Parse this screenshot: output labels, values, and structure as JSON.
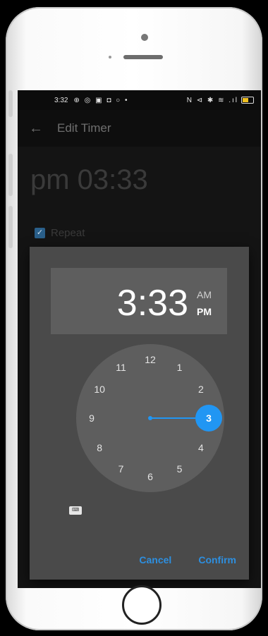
{
  "status_bar": {
    "time": "3:32",
    "left_icons": "⊕ ◎ ▣ ◘ ○ •",
    "right_icons": "N ⊲ ✱ ≋ .ıl",
    "battery_icon": "battery-icon"
  },
  "app_bar": {
    "back_icon": "back-arrow-icon",
    "back_glyph": "←",
    "title": "Edit Timer"
  },
  "background": {
    "time_display": "pm 03:33",
    "repeat_label": "Repeat",
    "repeat_checked": true,
    "check_glyph": "✓"
  },
  "time_picker": {
    "time": "3:33",
    "am_label": "AM",
    "pm_label": "PM",
    "selected_period": "PM",
    "clock_numbers": [
      "12",
      "1",
      "2",
      "3",
      "4",
      "5",
      "6",
      "7",
      "8",
      "9",
      "10",
      "11"
    ],
    "selected_hour": "3",
    "keyboard_icon": "keyboard-icon",
    "keyboard_glyph": "⌨",
    "cancel_label": "Cancel",
    "confirm_label": "Confirm",
    "accent_color": "#2196f3"
  }
}
